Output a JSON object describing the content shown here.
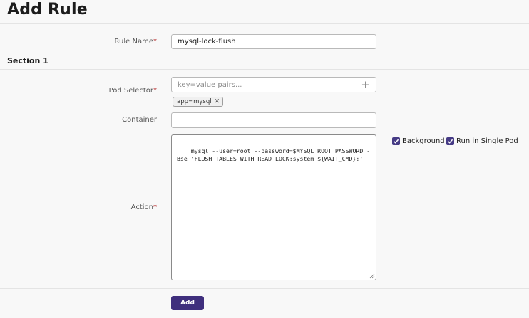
{
  "page": {
    "title": "Add Rule"
  },
  "rule_name": {
    "label": "Rule Name",
    "value": "mysql-lock-flush"
  },
  "section": {
    "title": "Section 1"
  },
  "pod_selector": {
    "label": "Pod Selector",
    "placeholder": "key=value pairs...",
    "tags": [
      "app=mysql"
    ]
  },
  "container": {
    "label": "Container",
    "value": ""
  },
  "action": {
    "label": "Action",
    "value": "mysql --user=root --password=$MYSQL_ROOT_PASSWORD -Bse 'FLUSH TABLES WITH READ LOCK;system ${WAIT_CMD};'"
  },
  "options": {
    "background": {
      "label": "Background",
      "checked": true
    },
    "run_single_pod": {
      "label": "Run in Single Pod",
      "checked": true
    }
  },
  "required_mark": "*",
  "buttons": {
    "add": "Add"
  },
  "colors": {
    "accent": "#3f2f7d",
    "required": "#b11f1f"
  }
}
